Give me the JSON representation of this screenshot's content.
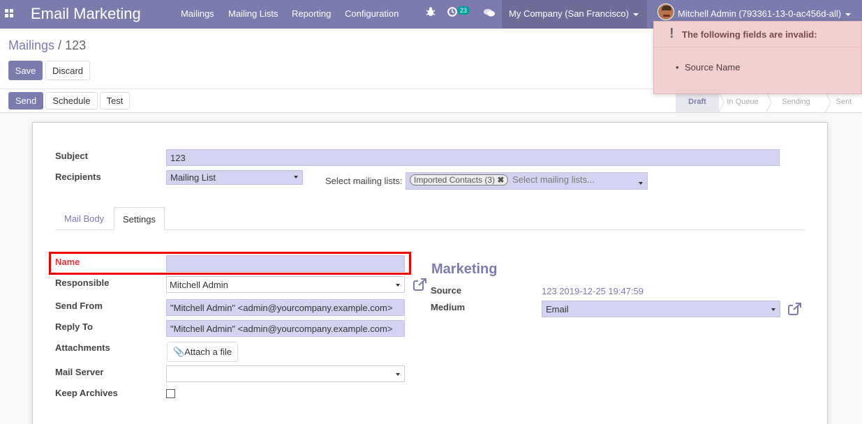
{
  "navbar": {
    "brand": "Email Marketing",
    "menu": [
      "Mailings",
      "Mailing Lists",
      "Reporting",
      "Configuration"
    ],
    "activity_count": "23",
    "company": "My Company (San Francisco)",
    "user": "Mitchell Admin (793361-13-0-ac456d-all)"
  },
  "breadcrumb": {
    "parent": "Mailings",
    "separator": "/",
    "current": "123"
  },
  "buttons": {
    "save": "Save",
    "discard": "Discard",
    "send": "Send",
    "schedule": "Schedule",
    "test": "Test"
  },
  "status_stages": [
    "Draft",
    "In Queue",
    "Sending",
    "Sent"
  ],
  "active_stage": "Draft",
  "form": {
    "subject_label": "Subject",
    "subject_value": "123",
    "recipients_label": "Recipients",
    "recipients_value": "Mailing List",
    "select_lists_label": "Select mailing lists:",
    "list_tag": "Imported Contacts (3)",
    "list_placeholder": "Select mailing lists...",
    "tabs": [
      "Mail Body",
      "Settings"
    ],
    "active_tab": "Settings",
    "name_label": "Name",
    "name_value": "",
    "responsible_label": "Responsible",
    "responsible_value": "Mitchell Admin",
    "send_from_label": "Send From",
    "send_from_value": "\"Mitchell Admin\" <admin@yourcompany.example.com>",
    "reply_to_label": "Reply To",
    "reply_to_value": "\"Mitchell Admin\" <admin@yourcompany.example.com>",
    "attachments_label": "Attachments",
    "attach_button": "Attach a file",
    "mail_server_label": "Mail Server",
    "mail_server_value": "",
    "keep_archives_label": "Keep Archives",
    "keep_archives_checked": false,
    "marketing_title": "Marketing",
    "source_label": "Source",
    "source_value": "123 2019-12-25 19:47:59",
    "medium_label": "Medium",
    "medium_value": "Email"
  },
  "notification": {
    "title": "The following fields are invalid:",
    "items": [
      "Source Name"
    ]
  },
  "colors": {
    "brand": "#7c7bad",
    "invalid_highlight": "#ee0000",
    "notification_bg": "#f2d0d0",
    "badge": "#00a09d"
  }
}
